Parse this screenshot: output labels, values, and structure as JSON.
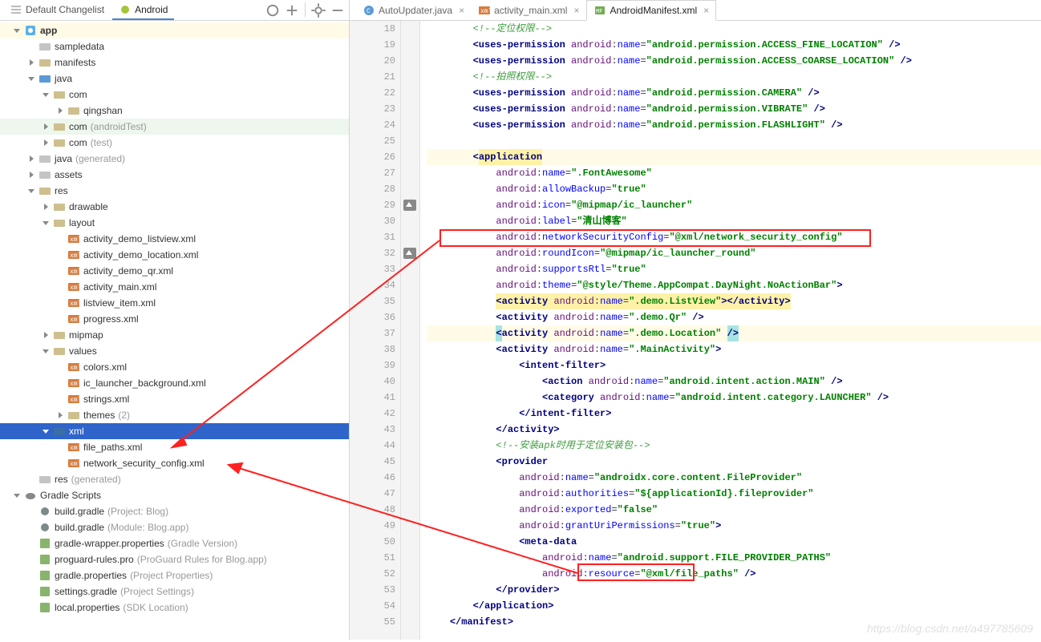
{
  "leftTabs": {
    "default": "Default Changelist",
    "android": "Android"
  },
  "tree": [
    {
      "d": 0,
      "a": "down",
      "i": "app",
      "bold": true,
      "t": "app",
      "hl": "yellow"
    },
    {
      "d": 1,
      "a": "none",
      "i": "folder-grey",
      "t": "sampledata"
    },
    {
      "d": 1,
      "a": "right",
      "i": "folder-khaki",
      "t": "manifests"
    },
    {
      "d": 1,
      "a": "down",
      "i": "folder-blue",
      "t": "java"
    },
    {
      "d": 2,
      "a": "down",
      "i": "folder-khaki",
      "t": "com"
    },
    {
      "d": 3,
      "a": "right",
      "i": "folder-khaki",
      "t": "qingshan"
    },
    {
      "d": 2,
      "a": "right",
      "i": "folder-khaki",
      "t": "com",
      "suffix": "(androidTest)",
      "hl": "green"
    },
    {
      "d": 2,
      "a": "right",
      "i": "folder-khaki",
      "t": "com",
      "suffix": "(test)"
    },
    {
      "d": 1,
      "a": "right",
      "i": "folder-grey",
      "t": "java",
      "suffix": "(generated)"
    },
    {
      "d": 1,
      "a": "right",
      "i": "folder-grey",
      "t": "assets"
    },
    {
      "d": 1,
      "a": "down",
      "i": "folder-khaki",
      "t": "res"
    },
    {
      "d": 2,
      "a": "right",
      "i": "folder-khaki",
      "t": "drawable"
    },
    {
      "d": 2,
      "a": "down",
      "i": "folder-khaki",
      "t": "layout"
    },
    {
      "d": 3,
      "a": "none",
      "i": "xml",
      "t": "activity_demo_listview.xml"
    },
    {
      "d": 3,
      "a": "none",
      "i": "xml",
      "t": "activity_demo_location.xml"
    },
    {
      "d": 3,
      "a": "none",
      "i": "xml",
      "t": "activity_demo_qr.xml"
    },
    {
      "d": 3,
      "a": "none",
      "i": "xml",
      "t": "activity_main.xml"
    },
    {
      "d": 3,
      "a": "none",
      "i": "xml",
      "t": "listview_item.xml"
    },
    {
      "d": 3,
      "a": "none",
      "i": "xml",
      "t": "progress.xml"
    },
    {
      "d": 2,
      "a": "right",
      "i": "folder-khaki",
      "t": "mipmap"
    },
    {
      "d": 2,
      "a": "down",
      "i": "folder-khaki",
      "t": "values"
    },
    {
      "d": 3,
      "a": "none",
      "i": "xml",
      "t": "colors.xml"
    },
    {
      "d": 3,
      "a": "none",
      "i": "xml",
      "t": "ic_launcher_background.xml"
    },
    {
      "d": 3,
      "a": "none",
      "i": "xml",
      "t": "strings.xml"
    },
    {
      "d": 3,
      "a": "right",
      "i": "folder-khaki",
      "t": "themes",
      "suffix": "(2)"
    },
    {
      "d": 2,
      "a": "down",
      "i": "folder-darkblue",
      "t": "xml",
      "selected": true
    },
    {
      "d": 3,
      "a": "none",
      "i": "xml",
      "t": "file_paths.xml"
    },
    {
      "d": 3,
      "a": "none",
      "i": "xml",
      "t": "network_security_config.xml"
    },
    {
      "d": 1,
      "a": "none",
      "i": "folder-grey",
      "t": "res",
      "suffix": "(generated)"
    },
    {
      "d": 0,
      "a": "down",
      "i": "elephant",
      "t": "Gradle Scripts"
    },
    {
      "d": 1,
      "a": "none",
      "i": "gradle",
      "t": "build.gradle",
      "suffix": "(Project: Blog)"
    },
    {
      "d": 1,
      "a": "none",
      "i": "gradle",
      "t": "build.gradle",
      "suffix": "(Module: Blog.app)"
    },
    {
      "d": 1,
      "a": "none",
      "i": "prop",
      "t": "gradle-wrapper.properties",
      "suffix": "(Gradle Version)"
    },
    {
      "d": 1,
      "a": "none",
      "i": "prop",
      "t": "proguard-rules.pro",
      "suffix": "(ProGuard Rules for Blog.app)"
    },
    {
      "d": 1,
      "a": "none",
      "i": "prop",
      "t": "gradle.properties",
      "suffix": "(Project Properties)"
    },
    {
      "d": 1,
      "a": "none",
      "i": "prop",
      "t": "settings.gradle",
      "suffix": "(Project Settings)"
    },
    {
      "d": 1,
      "a": "none",
      "i": "prop",
      "t": "local.properties",
      "suffix": "(SDK Location)"
    }
  ],
  "editorTabs": [
    {
      "icon": "java",
      "label": "AutoUpdater.java"
    },
    {
      "icon": "xml",
      "label": "activity_main.xml"
    },
    {
      "icon": "mf",
      "label": "AndroidManifest.xml",
      "active": true
    }
  ],
  "gutterPics": {
    "29": true,
    "32": true
  },
  "lines": [
    {
      "n": 18,
      "ind": 2,
      "seg": [
        {
          "c": "comment-cn",
          "t": "<!--定位权限-->"
        }
      ]
    },
    {
      "n": 19,
      "ind": 2,
      "seg": [
        {
          "c": "tag",
          "t": "<uses-permission "
        },
        {
          "c": "attr-ns",
          "t": "android"
        },
        {
          "t": ":"
        },
        {
          "c": "attr",
          "t": "name"
        },
        {
          "t": "="
        },
        {
          "c": "val",
          "t": "\"android.permission.ACCESS_FINE_LOCATION\""
        },
        {
          "c": "tag",
          "t": " />"
        }
      ]
    },
    {
      "n": 20,
      "ind": 2,
      "seg": [
        {
          "c": "tag",
          "t": "<uses-permission "
        },
        {
          "c": "attr-ns",
          "t": "android"
        },
        {
          "t": ":"
        },
        {
          "c": "attr",
          "t": "name"
        },
        {
          "t": "="
        },
        {
          "c": "val",
          "t": "\"android.permission.ACCESS_COARSE_LOCATION\""
        },
        {
          "c": "tag",
          "t": " />"
        }
      ]
    },
    {
      "n": 21,
      "ind": 2,
      "seg": [
        {
          "c": "comment-cn",
          "t": "<!--拍照权限-->"
        }
      ]
    },
    {
      "n": 22,
      "ind": 2,
      "seg": [
        {
          "c": "tag",
          "t": "<uses-permission "
        },
        {
          "c": "attr-ns",
          "t": "android"
        },
        {
          "t": ":"
        },
        {
          "c": "attr",
          "t": "name"
        },
        {
          "t": "="
        },
        {
          "c": "val",
          "t": "\"android.permission.CAMERA\""
        },
        {
          "c": "tag",
          "t": " />"
        }
      ]
    },
    {
      "n": 23,
      "ind": 2,
      "seg": [
        {
          "c": "tag",
          "t": "<uses-permission "
        },
        {
          "c": "attr-ns",
          "t": "android"
        },
        {
          "t": ":"
        },
        {
          "c": "attr",
          "t": "name"
        },
        {
          "t": "="
        },
        {
          "c": "val",
          "t": "\"android.permission.VIBRATE\""
        },
        {
          "c": "tag",
          "t": " />"
        }
      ]
    },
    {
      "n": 24,
      "ind": 2,
      "seg": [
        {
          "c": "tag",
          "t": "<uses-permission "
        },
        {
          "c": "attr-ns",
          "t": "android"
        },
        {
          "t": ":"
        },
        {
          "c": "attr",
          "t": "name"
        },
        {
          "t": "="
        },
        {
          "c": "val",
          "t": "\"android.permission.FLASHLIGHT\""
        },
        {
          "c": "tag",
          "t": " />"
        }
      ]
    },
    {
      "n": 25,
      "ind": 0,
      "seg": []
    },
    {
      "n": 26,
      "ind": 2,
      "seg": [
        {
          "c": "tag",
          "t": "<"
        },
        {
          "c": "tag",
          "hl": "yel",
          "t": "application"
        }
      ],
      "hl": "yellow"
    },
    {
      "n": 27,
      "ind": 3,
      "seg": [
        {
          "c": "attr-ns",
          "t": "android"
        },
        {
          "t": ":"
        },
        {
          "c": "attr",
          "t": "name"
        },
        {
          "t": "="
        },
        {
          "c": "val",
          "t": "\".FontAwesome\""
        }
      ]
    },
    {
      "n": 28,
      "ind": 3,
      "seg": [
        {
          "c": "attr-ns",
          "t": "android"
        },
        {
          "t": ":"
        },
        {
          "c": "attr",
          "t": "allowBackup"
        },
        {
          "t": "="
        },
        {
          "c": "val",
          "t": "\"true\""
        }
      ]
    },
    {
      "n": 29,
      "ind": 3,
      "seg": [
        {
          "c": "attr-ns",
          "t": "android"
        },
        {
          "t": ":"
        },
        {
          "c": "attr",
          "t": "icon"
        },
        {
          "t": "="
        },
        {
          "c": "val",
          "t": "\"@mipmap/ic_launcher\""
        }
      ]
    },
    {
      "n": 30,
      "ind": 3,
      "seg": [
        {
          "c": "attr-ns",
          "t": "android"
        },
        {
          "t": ":"
        },
        {
          "c": "attr",
          "t": "label"
        },
        {
          "t": "="
        },
        {
          "c": "val",
          "t": "\"清山博客\""
        }
      ]
    },
    {
      "n": 31,
      "ind": 3,
      "seg": [
        {
          "c": "attr-ns",
          "t": "android"
        },
        {
          "t": ":"
        },
        {
          "c": "attr",
          "t": "networkSecurityConfig"
        },
        {
          "t": "="
        },
        {
          "c": "val",
          "t": "\"@xml/network_security_config\""
        }
      ]
    },
    {
      "n": 32,
      "ind": 3,
      "seg": [
        {
          "c": "attr-ns",
          "t": "android"
        },
        {
          "t": ":"
        },
        {
          "c": "attr",
          "t": "roundIcon"
        },
        {
          "t": "="
        },
        {
          "c": "val",
          "t": "\"@mipmap/ic_launcher_round\""
        }
      ]
    },
    {
      "n": 33,
      "ind": 3,
      "seg": [
        {
          "c": "attr-ns",
          "t": "android"
        },
        {
          "t": ":"
        },
        {
          "c": "attr",
          "t": "supportsRtl"
        },
        {
          "t": "="
        },
        {
          "c": "val",
          "t": "\"true\""
        }
      ]
    },
    {
      "n": 34,
      "ind": 3,
      "seg": [
        {
          "c": "attr-ns",
          "t": "android"
        },
        {
          "t": ":"
        },
        {
          "c": "attr",
          "t": "theme"
        },
        {
          "t": "="
        },
        {
          "c": "val",
          "t": "\"@style/Theme.AppCompat.DayNight.NoActionBar\""
        },
        {
          "c": "tag",
          "t": ">"
        }
      ]
    },
    {
      "n": 35,
      "ind": 3,
      "seg": [
        {
          "c": "tag",
          "hl": "yel",
          "t": "<activity "
        },
        {
          "c": "attr-ns",
          "hl": "yel",
          "t": "android"
        },
        {
          "t": ":",
          "hl": "yel"
        },
        {
          "c": "attr",
          "hl": "yel",
          "t": "name"
        },
        {
          "t": "=",
          "hl": "yel"
        },
        {
          "c": "val",
          "hl": "yel",
          "t": "\".demo.ListView\""
        },
        {
          "c": "tag",
          "hl": "yel",
          "t": "></activity>"
        }
      ]
    },
    {
      "n": 36,
      "ind": 3,
      "seg": [
        {
          "c": "tag",
          "t": "<activity "
        },
        {
          "c": "attr-ns",
          "t": "android"
        },
        {
          "t": ":"
        },
        {
          "c": "attr",
          "t": "name"
        },
        {
          "t": "="
        },
        {
          "c": "val",
          "t": "\".demo.Qr\""
        },
        {
          "c": "tag",
          "t": " />"
        }
      ]
    },
    {
      "n": 37,
      "ind": 3,
      "seg": [
        {
          "c": "tag",
          "hl": "teal",
          "t": "<"
        },
        {
          "c": "tag",
          "t": "activity "
        },
        {
          "c": "attr-ns",
          "t": "android"
        },
        {
          "t": ":"
        },
        {
          "c": "attr",
          "t": "name"
        },
        {
          "t": "="
        },
        {
          "c": "val",
          "t": "\".demo.Location\" "
        },
        {
          "c": "tag",
          "hl": "teal",
          "t": "/>"
        }
      ],
      "hl": "yellow"
    },
    {
      "n": 38,
      "ind": 3,
      "seg": [
        {
          "c": "tag",
          "t": "<activity "
        },
        {
          "c": "attr-ns",
          "t": "android"
        },
        {
          "t": ":"
        },
        {
          "c": "attr",
          "t": "name"
        },
        {
          "t": "="
        },
        {
          "c": "val",
          "t": "\".MainActivity\""
        },
        {
          "c": "tag",
          "t": ">"
        }
      ]
    },
    {
      "n": 39,
      "ind": 4,
      "seg": [
        {
          "c": "tag",
          "t": "<intent-filter>"
        }
      ]
    },
    {
      "n": 40,
      "ind": 5,
      "seg": [
        {
          "c": "tag",
          "t": "<action "
        },
        {
          "c": "attr-ns",
          "t": "android"
        },
        {
          "t": ":"
        },
        {
          "c": "attr",
          "t": "name"
        },
        {
          "t": "="
        },
        {
          "c": "val",
          "t": "\"android.intent.action.MAIN\""
        },
        {
          "c": "tag",
          "t": " />"
        }
      ]
    },
    {
      "n": 41,
      "ind": 5,
      "seg": [
        {
          "c": "tag",
          "t": "<category "
        },
        {
          "c": "attr-ns",
          "t": "android"
        },
        {
          "t": ":"
        },
        {
          "c": "attr",
          "t": "name"
        },
        {
          "t": "="
        },
        {
          "c": "val",
          "t": "\"android.intent.category.LAUNCHER\""
        },
        {
          "c": "tag",
          "t": " />"
        }
      ]
    },
    {
      "n": 42,
      "ind": 4,
      "seg": [
        {
          "c": "tag",
          "t": "</intent-filter>"
        }
      ]
    },
    {
      "n": 43,
      "ind": 3,
      "seg": [
        {
          "c": "tag",
          "t": "</activity>"
        }
      ]
    },
    {
      "n": 44,
      "ind": 3,
      "seg": [
        {
          "c": "comment-cn",
          "t": "<!--安装apk时用于定位安装包-->"
        }
      ]
    },
    {
      "n": 45,
      "ind": 3,
      "seg": [
        {
          "c": "tag",
          "t": "<provider"
        }
      ]
    },
    {
      "n": 46,
      "ind": 4,
      "seg": [
        {
          "c": "attr-ns",
          "t": "android"
        },
        {
          "t": ":"
        },
        {
          "c": "attr",
          "t": "name"
        },
        {
          "t": "="
        },
        {
          "c": "val",
          "t": "\"androidx.core.content.FileProvider\""
        }
      ]
    },
    {
      "n": 47,
      "ind": 4,
      "seg": [
        {
          "c": "attr-ns",
          "t": "android"
        },
        {
          "t": ":"
        },
        {
          "c": "attr",
          "t": "authorities"
        },
        {
          "t": "="
        },
        {
          "c": "val",
          "t": "\"${applicationId}.fileprovider\""
        }
      ]
    },
    {
      "n": 48,
      "ind": 4,
      "seg": [
        {
          "c": "attr-ns",
          "t": "android"
        },
        {
          "t": ":"
        },
        {
          "c": "attr",
          "t": "exported"
        },
        {
          "t": "="
        },
        {
          "c": "val",
          "t": "\"false\""
        }
      ]
    },
    {
      "n": 49,
      "ind": 4,
      "seg": [
        {
          "c": "attr-ns",
          "t": "android"
        },
        {
          "t": ":"
        },
        {
          "c": "attr",
          "t": "grantUriPermissions"
        },
        {
          "t": "="
        },
        {
          "c": "val",
          "t": "\"true\""
        },
        {
          "c": "tag",
          "t": ">"
        }
      ]
    },
    {
      "n": 50,
      "ind": 4,
      "seg": [
        {
          "c": "tag",
          "t": "<meta-data"
        }
      ]
    },
    {
      "n": 51,
      "ind": 5,
      "seg": [
        {
          "c": "attr-ns",
          "t": "android"
        },
        {
          "t": ":"
        },
        {
          "c": "attr",
          "t": "name"
        },
        {
          "t": "="
        },
        {
          "c": "val",
          "t": "\"android.support.FILE_PROVIDER_PATHS\""
        }
      ]
    },
    {
      "n": 52,
      "ind": 5,
      "seg": [
        {
          "c": "attr-ns",
          "t": "android"
        },
        {
          "t": ":"
        },
        {
          "c": "attr",
          "t": "resource"
        },
        {
          "t": "="
        },
        {
          "c": "val",
          "t": "\"@xml/file_paths\""
        },
        {
          "c": "tag",
          "t": " />"
        }
      ]
    },
    {
      "n": 53,
      "ind": 3,
      "seg": [
        {
          "c": "tag",
          "t": "</provider>"
        }
      ]
    },
    {
      "n": 54,
      "ind": 2,
      "seg": [
        {
          "c": "tag",
          "t": "</application>"
        }
      ]
    },
    {
      "n": 55,
      "ind": 1,
      "seg": [
        {
          "c": "tag",
          "t": "</manifest>"
        }
      ]
    }
  ],
  "watermark": "https://blog.csdn.net/a497785609"
}
